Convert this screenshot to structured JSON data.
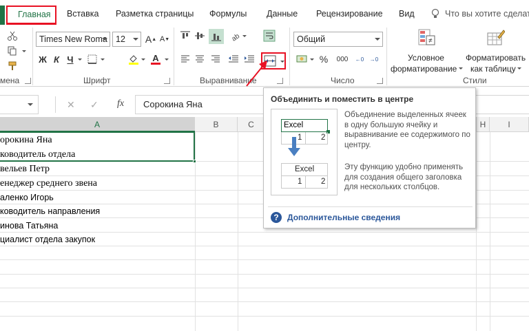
{
  "tabs": [
    {
      "label": "Главная"
    },
    {
      "label": "Вставка"
    },
    {
      "label": "Разметка страницы"
    },
    {
      "label": "Формулы"
    },
    {
      "label": "Данные"
    },
    {
      "label": "Рецензирование"
    },
    {
      "label": "Вид"
    }
  ],
  "tell_me": {
    "placeholder": "Что вы хотите сделать"
  },
  "ribbon": {
    "clipboard_label": "мена",
    "font_group_label": "Шрифт",
    "font_name": "Times New Roma",
    "font_size": "12",
    "bold": "Ж",
    "italic": "К",
    "underline": "Ч",
    "font_color_letter": "А",
    "align_group_label": "Выравнивание",
    "number_group_label": "Число",
    "number_format": "Общий",
    "percent": "%",
    "thousands": "000",
    "styles_group_label": "Стили",
    "conditional_format_line1": "Условное",
    "conditional_format_line2": "форматирование",
    "format_table_line1": "Форматировать",
    "format_table_line2": "как таблицу"
  },
  "formula_bar": {
    "fx": "fx",
    "value": "Сорокина Яна"
  },
  "columns": [
    "A",
    "B",
    "C",
    "H",
    "I"
  ],
  "cells": [
    "орокина Яна",
    "ководитель отдела",
    "вельев Петр",
    "енеджер среднего звена",
    "аленко Игорь",
    "ководитель направления",
    "инова Татьяна",
    "циалист отдела закупок"
  ],
  "tooltip": {
    "title": "Объединить и поместить в центре",
    "desc1": "Объединение выделенных ячеек в одну большую ячейку и выравнивание ее содержимого по центру.",
    "desc2": "Эту функцию удобно применять для создания общего заголовка для нескольких столбцов.",
    "help_icon": "?",
    "help_text": "Дополнительные сведения",
    "illus_top_text": "Excel",
    "illus_top_nums": [
      "1",
      "2"
    ],
    "illus_bottom_text": "Excel",
    "illus_bottom_nums": [
      "1",
      "2"
    ]
  },
  "colors": {
    "accent": "#217346",
    "highlight_red": "#e81123",
    "help_blue": "#2b579a",
    "selected_button": "#c5e0d0"
  }
}
